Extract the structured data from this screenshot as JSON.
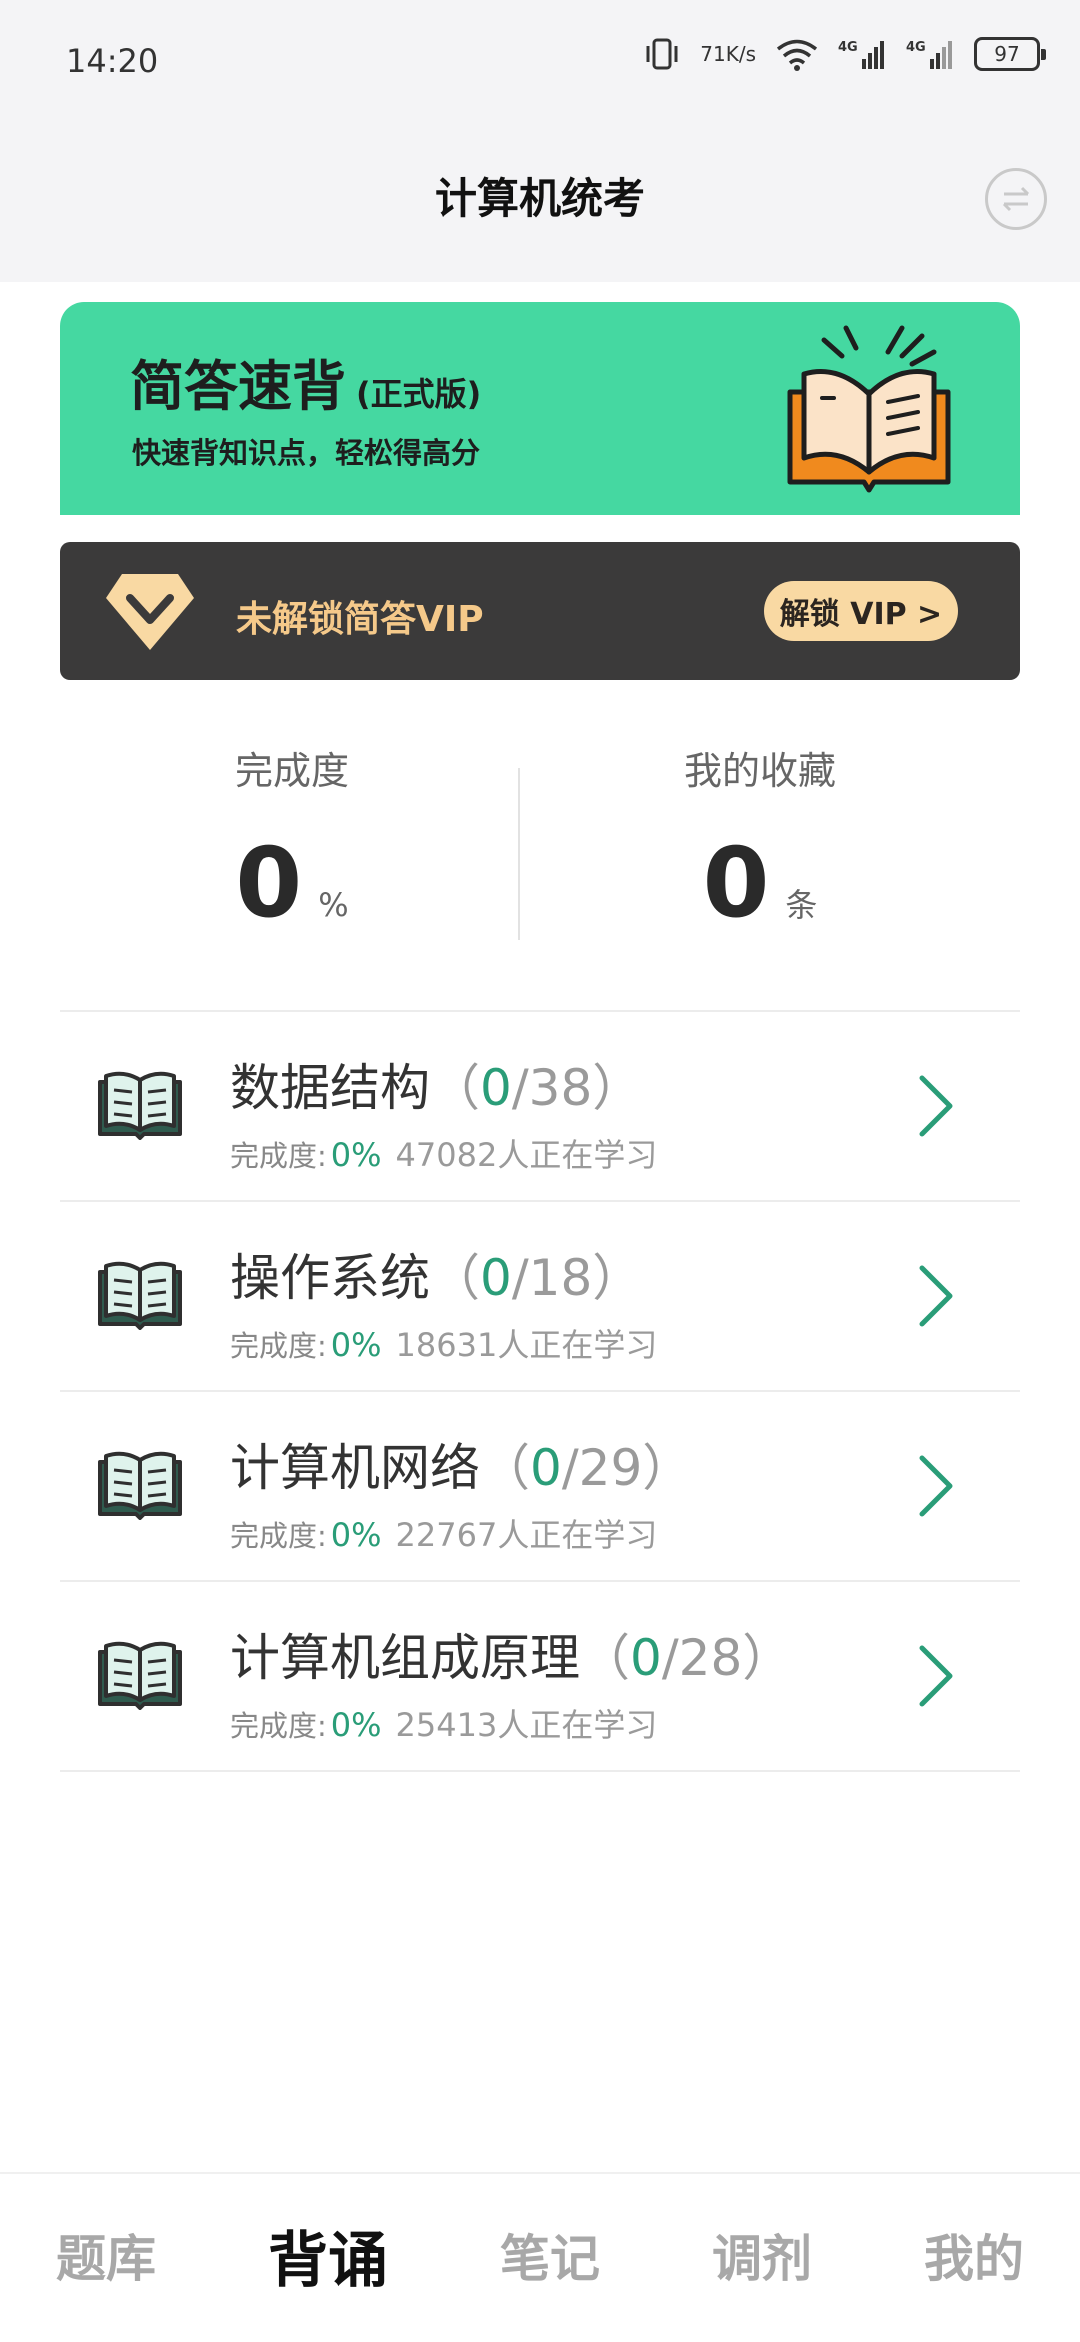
{
  "status_bar": {
    "time": "14:20",
    "net_speed_value": "71",
    "net_speed_unit": "K/s",
    "battery": "97"
  },
  "header": {
    "title": "计算机统考",
    "switch_icon": "swap-arrows-icon"
  },
  "banner": {
    "title": "简答速背",
    "edition": "(正式版)",
    "subtitle": "快速背知识点，轻松得高分",
    "icon": "open-book-icon",
    "color": "#45d8a1"
  },
  "vip": {
    "text": "未解锁简答VIP",
    "button_label": "解锁 VIP >",
    "icon": "diamond-icon"
  },
  "stats": {
    "completion_label": "完成度",
    "completion_value": "0",
    "completion_unit": "%",
    "favorites_label": "我的收藏",
    "favorites_value": "0",
    "favorites_unit": "条"
  },
  "subjects": [
    {
      "name": "数据结构",
      "open": "（",
      "done": "0",
      "total": "/38",
      "close": "）",
      "progress_label": "完成度:",
      "progress": "0%",
      "learners": "47082人正在学习"
    },
    {
      "name": "操作系统",
      "open": "（",
      "done": "0",
      "total": "/18",
      "close": "）",
      "progress_label": "完成度:",
      "progress": "0%",
      "learners": "18631人正在学习"
    },
    {
      "name": "计算机网络",
      "open": "（",
      "done": "0",
      "total": "/29",
      "close": "）",
      "progress_label": "完成度:",
      "progress": "0%",
      "learners": "22767人正在学习"
    },
    {
      "name": "计算机组成原理",
      "open": "（",
      "done": "0",
      "total": "/28",
      "close": "）",
      "progress_label": "完成度:",
      "progress": "0%",
      "learners": "25413人正在学习"
    }
  ],
  "bottom_nav": {
    "items": [
      "题库",
      "背诵",
      "笔记",
      "调剂",
      "我的"
    ],
    "active": "背诵"
  },
  "colors": {
    "accent_green": "#2a9d78",
    "vip_gold": "#f5c98a",
    "vip_bg": "#3b3a3a"
  }
}
